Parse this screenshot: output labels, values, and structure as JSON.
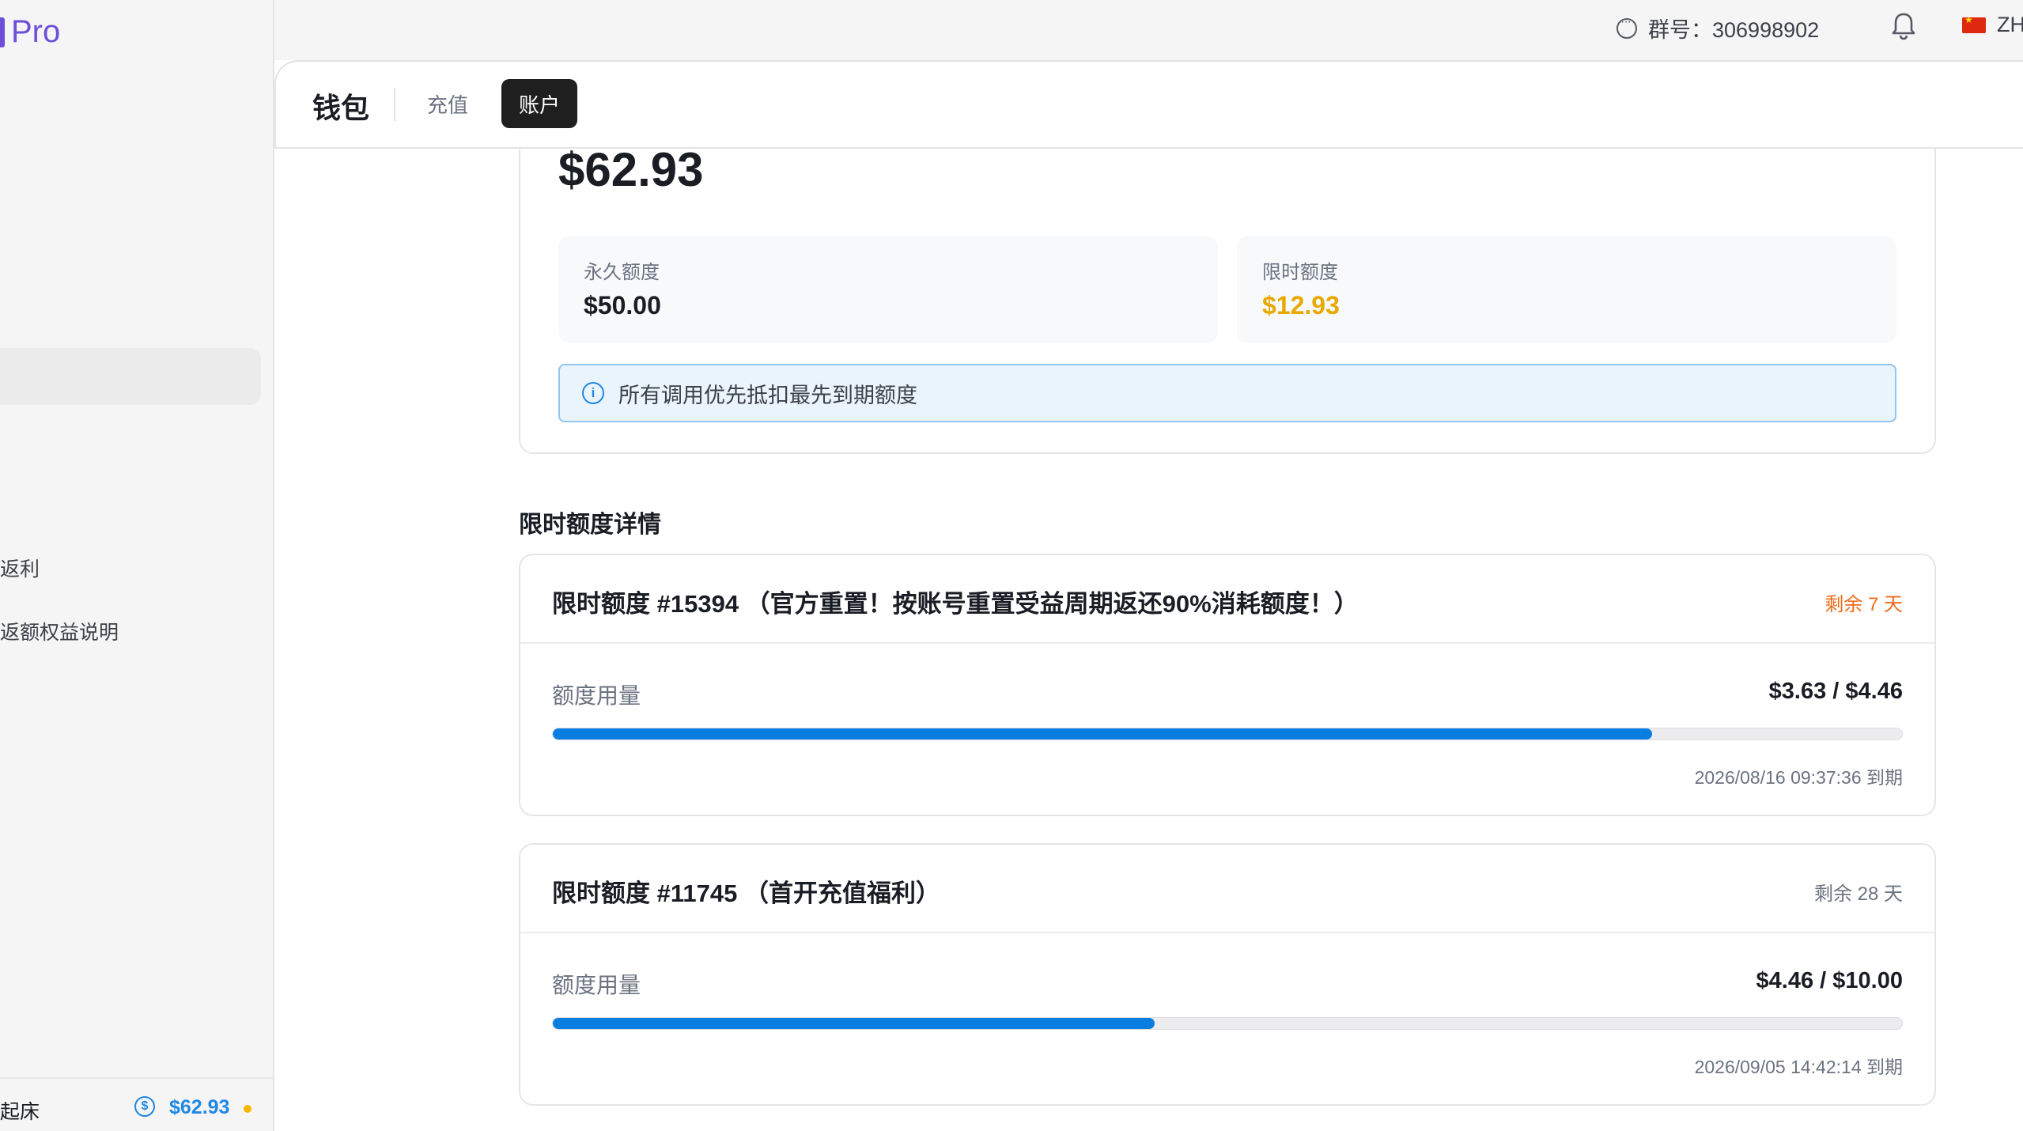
{
  "sidebar": {
    "logo_text": "Pro",
    "items": [
      {
        "label": "返利"
      },
      {
        "label": "返额权益说明"
      }
    ],
    "footer": {
      "name": "起床",
      "balance": "$62.93"
    }
  },
  "topbar": {
    "group": "群号：306998902",
    "lang": "ZH"
  },
  "header": {
    "title": "钱包",
    "tabs": [
      {
        "label": "充值",
        "active": false
      },
      {
        "label": "账户",
        "active": true
      }
    ]
  },
  "wallet": {
    "total": "$62.93",
    "permanent": {
      "label": "永久额度",
      "value": "$50.00"
    },
    "limited": {
      "label": "限时额度",
      "value": "$12.93"
    },
    "notice": "所有调用优先抵扣最先到期额度"
  },
  "details": {
    "section_title": "限时额度详情",
    "usage_label": "额度用量",
    "items": [
      {
        "title": "限时额度 #15394 （官方重置！按账号重置受益周期返还90%消耗额度！）",
        "days_left": "剩余 7 天",
        "days_color": "#ef6c1a",
        "used": "$3.63 / $4.46",
        "progress": 0.815,
        "expiry": "2026/08/16 09:37:36 到期"
      },
      {
        "title": "限时额度 #11745 （首开充值福利）",
        "days_left": "剩余 28 天",
        "days_color": "#6b7280",
        "used": "$4.46 / $10.00",
        "progress": 0.446,
        "expiry": "2026/09/05 14:42:14 到期"
      }
    ]
  },
  "colors": {
    "accent": "#0a7ee0",
    "limited_value": "#e8a800",
    "brand": "#6d4fd8"
  }
}
